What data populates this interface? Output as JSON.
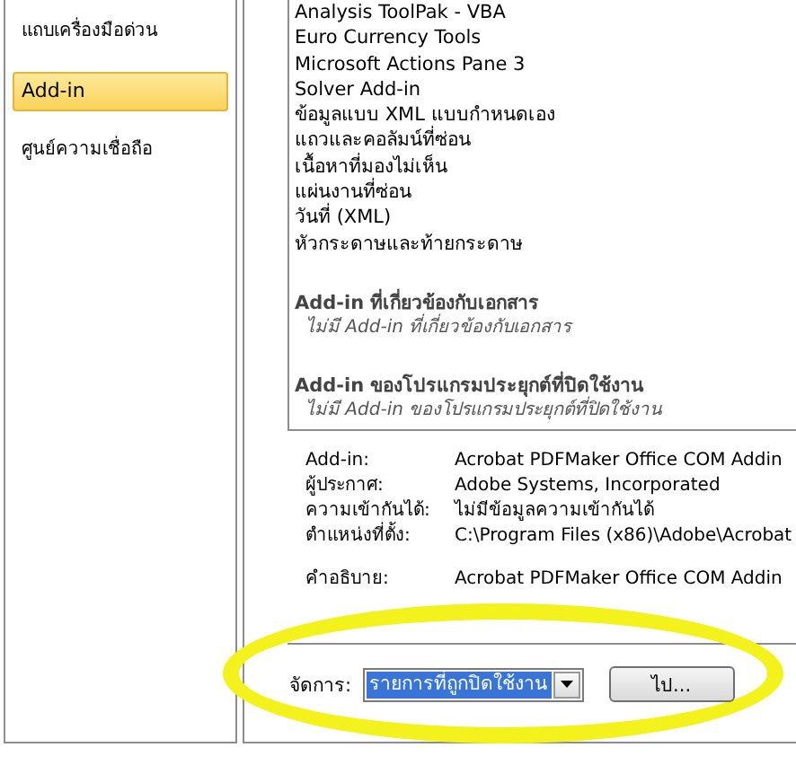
{
  "sidebar": {
    "items": [
      {
        "label": "แถบเครื่องมือด่วน",
        "selected": false
      },
      {
        "label": "Add-in",
        "selected": true
      },
      {
        "label": "ศูนย์ความเชื่อถือ",
        "selected": false
      }
    ]
  },
  "addin_list": {
    "items": [
      "Analysis ToolPak - VBA",
      "Euro Currency Tools",
      "Microsoft Actions Pane 3",
      "Solver Add-in",
      "ข้อมูลแบบ XML แบบกำหนดเอง",
      "แถวและคอลัมน์ที่ซ่อน",
      "เนื้อหาที่มองไม่เห็น",
      "แผ่นงานที่ซ่อน",
      "วันที่ (XML)",
      "หัวกระดาษและท้ายกระดาษ"
    ],
    "groups": [
      {
        "title": "Add-in ที่เกี่ยวข้องกับเอกสาร",
        "empty_note": "ไม่มี Add-in ที่เกี่ยวข้องกับเอกสาร"
      },
      {
        "title": "Add-in ของโปรแกรมประยุกต์ที่ปิดใช้งาน",
        "empty_note": "ไม่มี Add-in ของโปรแกรมประยุกต์ที่ปิดใช้งาน"
      }
    ]
  },
  "details": [
    {
      "label": "Add-in:",
      "value": "Acrobat PDFMaker Office COM Addin"
    },
    {
      "label": "ผู้ประกาศ:",
      "value": "Adobe Systems, Incorporated"
    },
    {
      "label": "ความเข้ากันได้:",
      "value": "ไม่มีข้อมูลความเข้ากันได้"
    },
    {
      "label": "ตำแหน่งที่ตั้ง:",
      "value": "C:\\Program Files (x86)\\Adobe\\Acrobat"
    },
    {
      "label": "คำอธิบาย:",
      "value": "Acrobat PDFMaker Office COM Addin"
    }
  ],
  "manage": {
    "label": "จัดการ:",
    "value": "รายการที่ถูกปิดใช้งาน",
    "button": "ไป..."
  }
}
